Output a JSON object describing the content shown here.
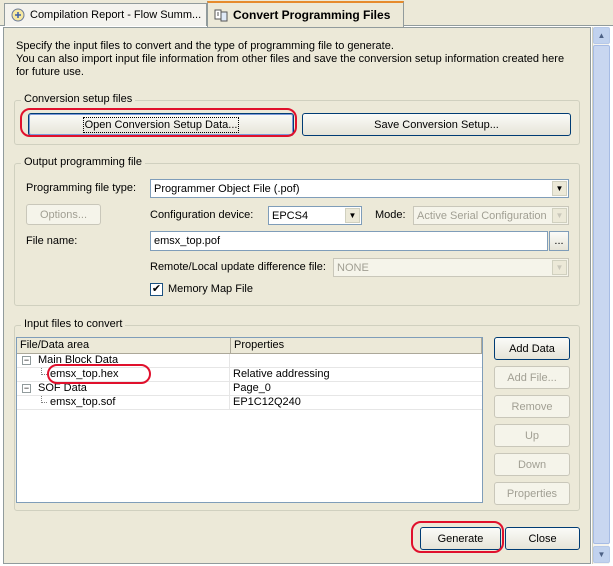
{
  "tabs": [
    {
      "label": "Compilation Report - Flow Summ..."
    },
    {
      "label": "Convert Programming Files"
    }
  ],
  "description": {
    "line1": "Specify the input files to convert and the type of programming file to generate.",
    "line2": "You can also import input file information from other files and save the conversion setup information created here for future use."
  },
  "setup_group": {
    "title": "Conversion setup files",
    "open_label": "Open Conversion Setup Data...",
    "save_label": "Save Conversion Setup..."
  },
  "output_group": {
    "title": "Output programming file",
    "file_type_label": "Programming file type:",
    "file_type_value": "Programmer Object File (.pof)",
    "options_label": "Options...",
    "config_device_label": "Configuration device:",
    "config_device_value": "EPCS4",
    "mode_label": "Mode:",
    "mode_value": "Active Serial Configuration",
    "file_name_label": "File name:",
    "file_name_value": "emsx_top.pof",
    "browse_label": "...",
    "update_diff_label": "Remote/Local update difference file:",
    "update_diff_value": "NONE",
    "memory_map_label": "Memory Map File",
    "memory_map_checked": true
  },
  "input_group": {
    "title": "Input files to convert",
    "columns": [
      "File/Data area",
      "Properties"
    ],
    "rows": [
      {
        "name": "Main Block Data",
        "prop": "",
        "expander": "−"
      },
      {
        "name": "emsx_top.hex",
        "prop": "Relative addressing",
        "expander": ""
      },
      {
        "name": "SOF Data",
        "prop": "Page_0",
        "expander": "−"
      },
      {
        "name": "emsx_top.sof",
        "prop": "EP1C12Q240",
        "expander": ""
      }
    ],
    "add_data_label": "Add Data",
    "add_file_label": "Add File...",
    "remove_label": "Remove",
    "up_label": "Up",
    "down_label": "Down",
    "properties_label": "Properties"
  },
  "footer": {
    "generate_label": "Generate",
    "close_label": "Close"
  },
  "colors": {
    "highlight_circle": "#e0102c",
    "panel_bg": "#ece9d8"
  }
}
